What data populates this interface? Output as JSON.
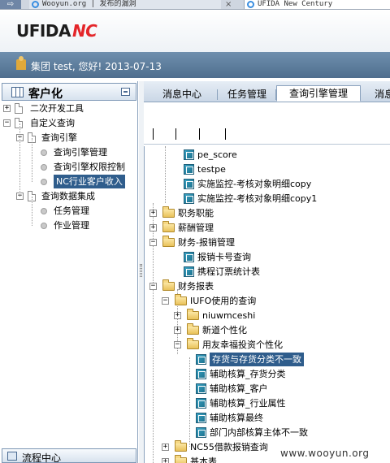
{
  "browser": {
    "tabs": [
      {
        "label": "Wooyun.org | 发布的漏洞"
      },
      {
        "label": "UFIDA New Century"
      }
    ],
    "close_glyph": "×",
    "back_glyph": "⇨"
  },
  "header": {
    "logo_word": "UFIDA",
    "logo_mark": "NC",
    "greeting": "集团 test, 您好! 2013-07-13"
  },
  "left_panel": {
    "title": "客户化",
    "tree": [
      {
        "label": "二次开发工具",
        "expander": "+"
      },
      {
        "label": "自定义查询",
        "expander": "−"
      },
      {
        "label": "查询引擎",
        "expander": "−"
      },
      {
        "label": "查询引擎管理"
      },
      {
        "label": "查询引擎权限控制"
      },
      {
        "label": "NC行业客户收入",
        "selected": true
      },
      {
        "label": "查询数据集成",
        "expander": "−"
      },
      {
        "label": "任务管理"
      },
      {
        "label": "作业管理"
      }
    ],
    "bottom_label": "流程中心"
  },
  "tabs": [
    {
      "label": "消息中心"
    },
    {
      "label": "任务管理"
    },
    {
      "label": "查询引擎管理",
      "active": true
    },
    {
      "label": "消息"
    }
  ],
  "right_tree": [
    {
      "label": "pe_score",
      "icon": "query-icon"
    },
    {
      "label": "testpe",
      "icon": "query-icon"
    },
    {
      "label": "实施监控-考核对象明细copy",
      "icon": "query-icon"
    },
    {
      "label": "实施监控-考核对象明细copy1",
      "icon": "query-icon"
    },
    {
      "label": "职务职能",
      "icon": "folder-icon",
      "expander": "+"
    },
    {
      "label": "薪酬管理",
      "icon": "folder-icon",
      "expander": "+"
    },
    {
      "label": "财务-报销管理",
      "icon": "folder-icon",
      "expander": "−"
    },
    {
      "label": "报销卡号查询",
      "icon": "query-icon"
    },
    {
      "label": "携程订票统计表",
      "icon": "query-icon"
    },
    {
      "label": "财务报表",
      "icon": "folder-icon",
      "expander": "−"
    },
    {
      "label": "IUFO使用的查询",
      "icon": "folder-icon",
      "expander": "−"
    },
    {
      "label": "niuwmceshi",
      "icon": "folder-icon",
      "expander": "+"
    },
    {
      "label": "新道个性化",
      "icon": "folder-icon",
      "expander": "+"
    },
    {
      "label": "用友幸福投资个性化",
      "icon": "folder-icon",
      "expander": "−"
    },
    {
      "label": "存货与存货分类不一致",
      "icon": "query-icon",
      "selected": true
    },
    {
      "label": "辅助核算_存货分类",
      "icon": "query-icon"
    },
    {
      "label": "辅助核算_客户",
      "icon": "query-icon"
    },
    {
      "label": "辅助核算_行业属性",
      "icon": "query-icon"
    },
    {
      "label": "辅助核算最终",
      "icon": "query-icon"
    },
    {
      "label": "部门内部核算主体不一致",
      "icon": "query-icon"
    },
    {
      "label": "NC55借款报销查询",
      "icon": "folder-icon",
      "expander": "+"
    },
    {
      "label": "基本表",
      "icon": "folder-icon",
      "expander": "+"
    }
  ],
  "watermark": "www.wooyun.org",
  "colors": {
    "selection": "#2f5d8c",
    "greet_bar": "#5a7a9a",
    "logo_accent": "#e4262a"
  }
}
